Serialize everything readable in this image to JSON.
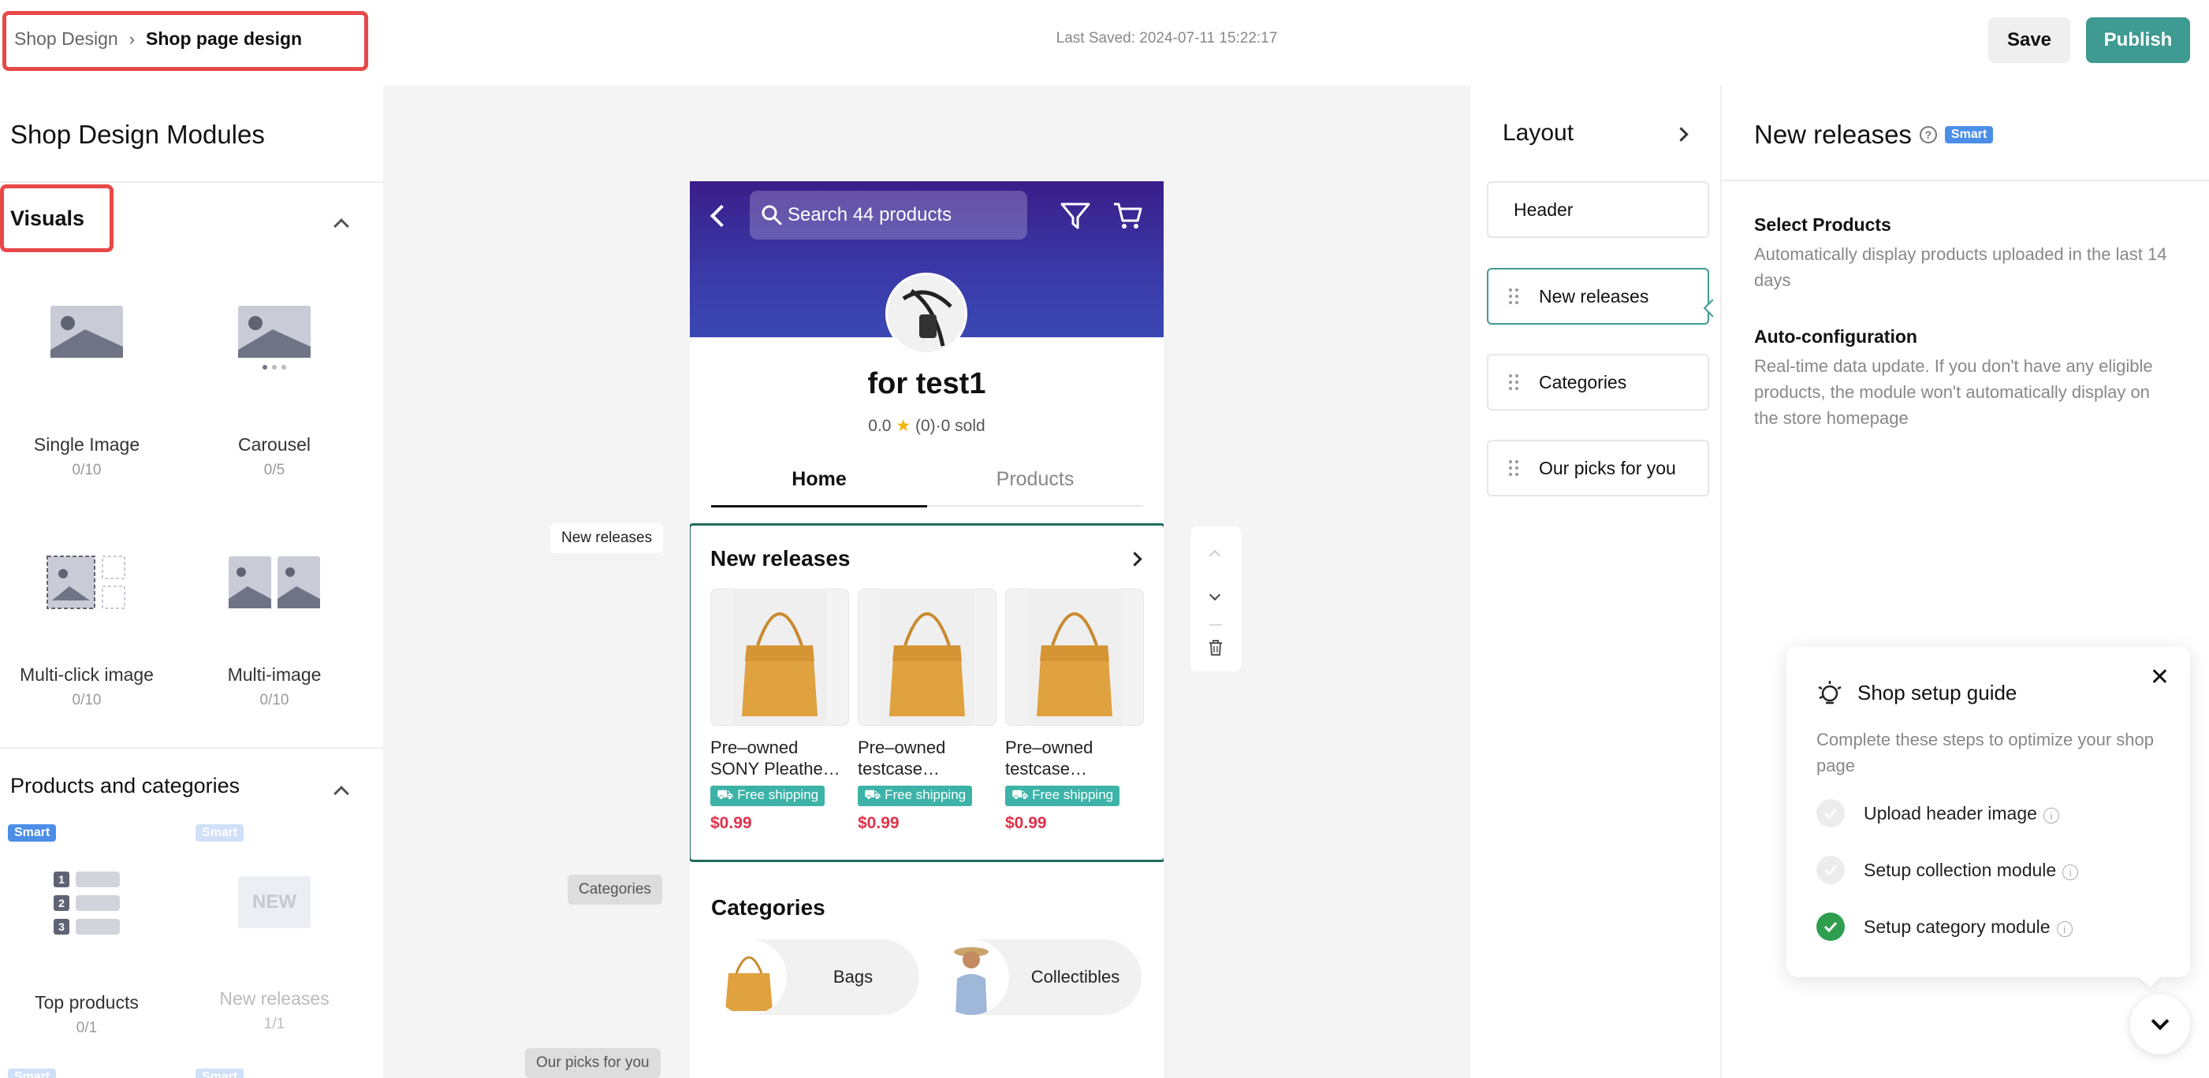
{
  "header": {
    "breadcrumb": {
      "parent": "Shop Design",
      "current": "Shop page design"
    },
    "last_saved": "Last Saved: 2024-07-11 15:22:17",
    "save_label": "Save",
    "publish_label": "Publish",
    "accent_color": "#3f9a91",
    "highlight_color": "#e84848"
  },
  "left_panel": {
    "title": "Shop Design Modules",
    "visuals": {
      "title": "Visuals",
      "modules": [
        {
          "label": "Single Image",
          "count": "0/10",
          "icon": "single-image-icon"
        },
        {
          "label": "Carousel",
          "count": "0/5",
          "icon": "carousel-icon"
        },
        {
          "label": "Multi-click image",
          "count": "0/10",
          "icon": "multi-click-image-icon"
        },
        {
          "label": "Multi-image",
          "count": "0/10",
          "icon": "multi-image-icon"
        }
      ]
    },
    "products": {
      "title": "Products and categories",
      "modules": [
        {
          "label": "Top products",
          "count": "0/1",
          "badge": "Smart",
          "icon": "top-products-icon",
          "rank": [
            "1",
            "2",
            "3"
          ]
        },
        {
          "label": "New releases",
          "count": "1/1",
          "badge": "Smart",
          "icon": "new-releases-icon",
          "icon_text": "NEW"
        }
      ],
      "next_row_badges": [
        "Smart",
        "Smart"
      ]
    }
  },
  "canvas": {
    "side_tags": {
      "new_releases": "New releases",
      "categories": "Categories",
      "our_picks": "Our picks for you"
    },
    "phone": {
      "search_placeholder": "Search 44 products",
      "shop_name": "for test1",
      "rating": "0.0",
      "stats_suffix": "(0)·0 sold",
      "tabs": {
        "home": "Home",
        "products": "Products"
      },
      "new_releases": {
        "title": "New releases",
        "products": [
          {
            "name": "Pre–owned SONY Pleathe…",
            "badge": "Free shipping",
            "price": "$0.99"
          },
          {
            "name": "Pre–owned testcase…",
            "badge": "Free shipping",
            "price": "$0.99"
          },
          {
            "name": "Pre–owned testcase…",
            "badge": "Free shipping",
            "price": "$0.99"
          }
        ]
      },
      "categories": {
        "title": "Categories",
        "items": [
          {
            "label": "Bags"
          },
          {
            "label": "Collectibles"
          }
        ]
      }
    }
  },
  "layout_panel": {
    "title": "Layout",
    "items": [
      {
        "label": "Header",
        "draggable": false,
        "active": false
      },
      {
        "label": "New releases",
        "draggable": true,
        "active": true
      },
      {
        "label": "Categories",
        "draggable": true,
        "active": false
      },
      {
        "label": "Our picks for you",
        "draggable": true,
        "active": false
      }
    ]
  },
  "props_panel": {
    "title": "New releases",
    "badge": "Smart",
    "select_products_heading": "Select Products",
    "select_products_text": "Automatically display products uploaded in the last 14 days",
    "auto_config_heading": "Auto-configuration",
    "auto_config_text": "Real-time data update. If you don't have any eligible products, the module won't automatically display on the store homepage"
  },
  "setup_guide": {
    "title": "Shop setup guide",
    "description": "Complete these steps to optimize your shop page",
    "steps": [
      {
        "label": "Upload header image",
        "done": false
      },
      {
        "label": "Setup collection module",
        "done": false
      },
      {
        "label": "Setup category module",
        "done": true
      }
    ]
  }
}
